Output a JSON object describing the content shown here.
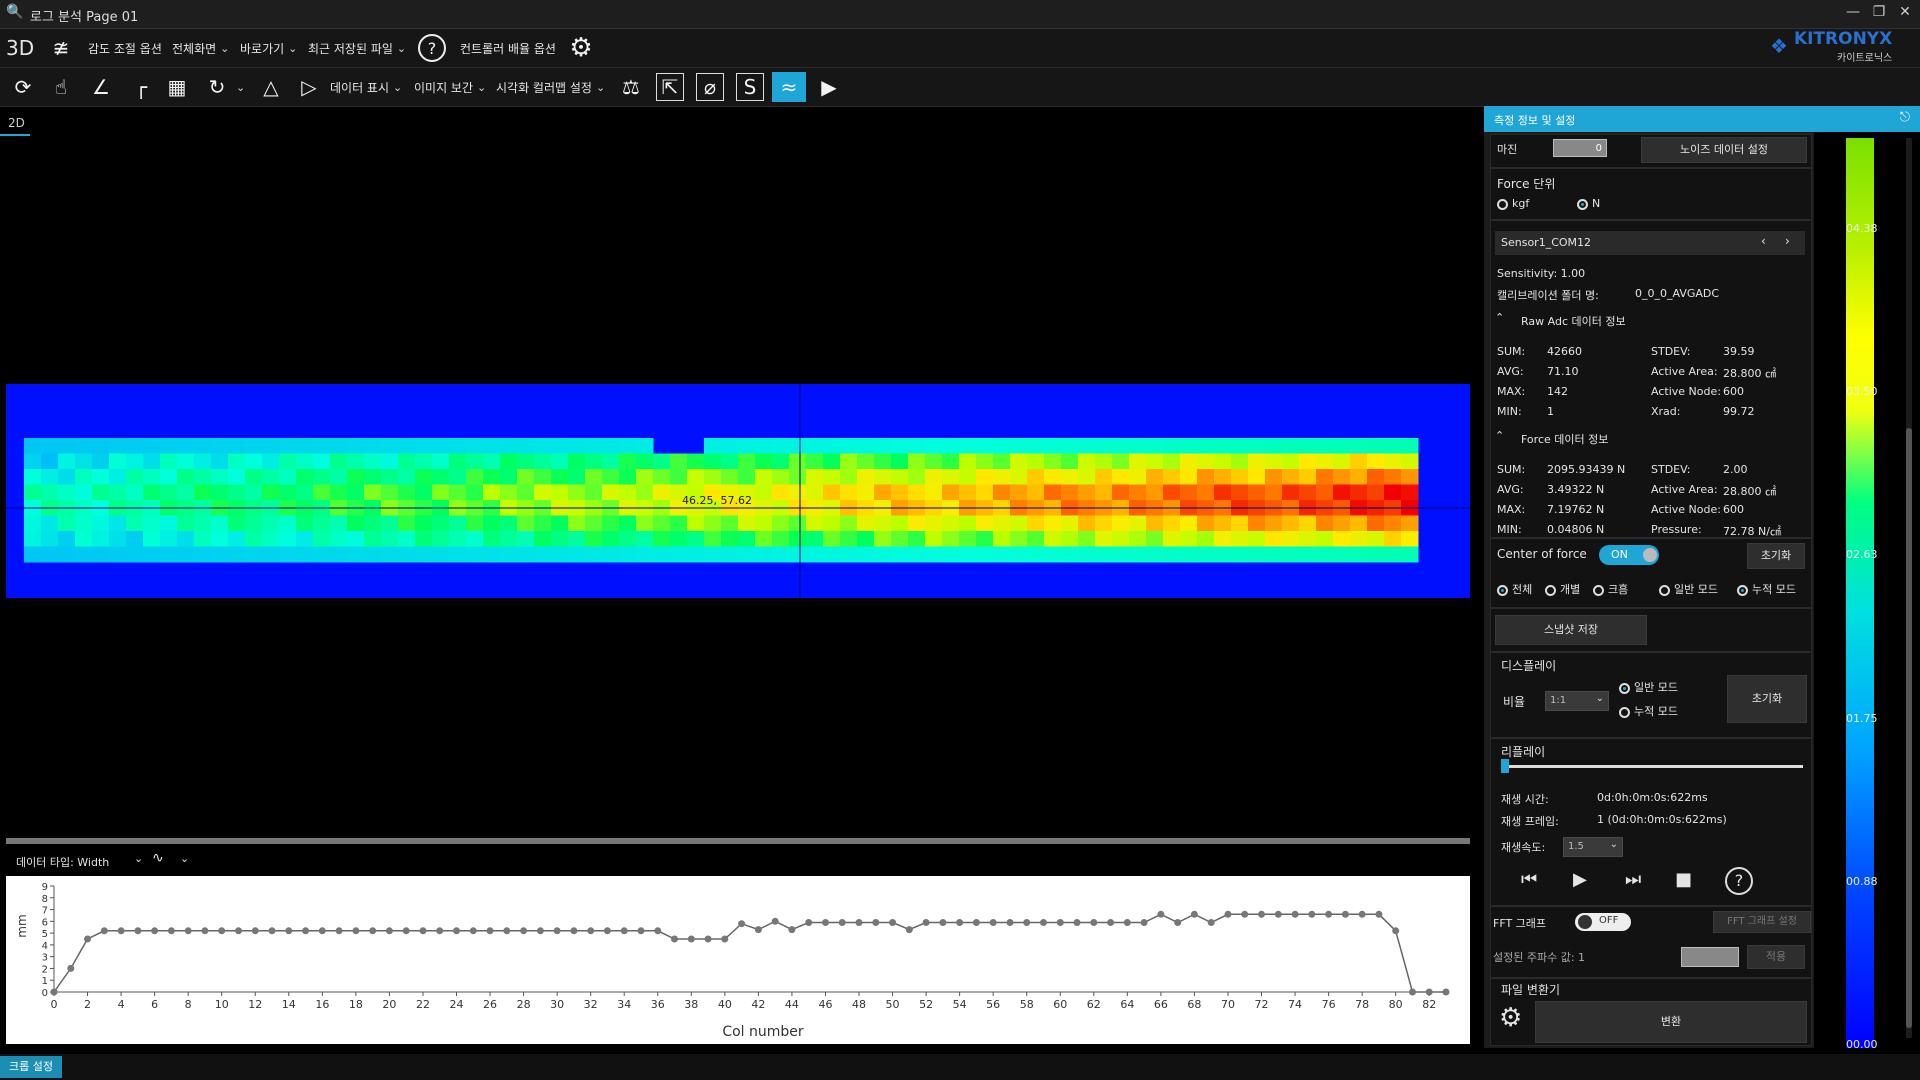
{
  "window": {
    "title": "로그 분석 Page 01"
  },
  "toolbar1": {
    "view3d": "3D",
    "items": [
      "감도 조절 옵션",
      "전체화면",
      "바로가기",
      "최근 저장된 파일",
      "컨트롤러 배율 옵션"
    ]
  },
  "toolbar2": {
    "items": [
      "데이터 표시",
      "이미지 보간",
      "시각화 컬러맵 설정"
    ]
  },
  "logo": {
    "name": "KITRONYX",
    "sub": "카이트로닉스"
  },
  "tabs": {
    "active": "2D"
  },
  "heatmap": {
    "rows": 8,
    "cols": 82,
    "center_label": "46.25, 57.62",
    "axis_color": "#000080"
  },
  "chart_data": {
    "type": "line",
    "title": "",
    "xlabel": "Col number",
    "ylabel": "mm",
    "xlim": [
      0,
      83
    ],
    "ylim": [
      0,
      9
    ],
    "x_ticks": [
      0,
      2,
      4,
      6,
      8,
      10,
      12,
      14,
      16,
      18,
      20,
      22,
      24,
      26,
      28,
      30,
      32,
      34,
      36,
      38,
      40,
      42,
      44,
      46,
      48,
      50,
      52,
      54,
      56,
      58,
      60,
      62,
      64,
      66,
      68,
      70,
      72,
      74,
      76,
      78,
      80,
      82
    ],
    "y_ticks": [
      0,
      1,
      2,
      3,
      4,
      5,
      6,
      7,
      8,
      9
    ],
    "x": [
      0,
      1,
      2,
      3,
      4,
      5,
      6,
      7,
      8,
      9,
      10,
      11,
      12,
      13,
      14,
      15,
      16,
      17,
      18,
      19,
      20,
      21,
      22,
      23,
      24,
      25,
      26,
      27,
      28,
      29,
      30,
      31,
      32,
      33,
      34,
      35,
      36,
      37,
      38,
      39,
      40,
      41,
      42,
      43,
      44,
      45,
      46,
      47,
      48,
      49,
      50,
      51,
      52,
      53,
      54,
      55,
      56,
      57,
      58,
      59,
      60,
      61,
      62,
      63,
      64,
      65,
      66,
      67,
      68,
      69,
      70,
      71,
      72,
      73,
      74,
      75,
      76,
      77,
      78,
      79,
      80,
      81,
      82,
      83
    ],
    "series": [
      {
        "values": [
          0,
          2,
          4.5,
          5.2,
          5.2,
          5.2,
          5.2,
          5.2,
          5.2,
          5.2,
          5.2,
          5.2,
          5.2,
          5.2,
          5.2,
          5.2,
          5.2,
          5.2,
          5.2,
          5.2,
          5.2,
          5.2,
          5.2,
          5.2,
          5.2,
          5.2,
          5.2,
          5.2,
          5.2,
          5.2,
          5.2,
          5.2,
          5.2,
          5.2,
          5.2,
          5.2,
          5.2,
          4.5,
          4.5,
          4.5,
          4.5,
          5.8,
          5.3,
          6,
          5.3,
          5.9,
          5.9,
          5.9,
          5.9,
          5.9,
          5.9,
          5.3,
          5.9,
          5.9,
          5.9,
          5.9,
          5.9,
          5.9,
          5.9,
          5.9,
          5.9,
          5.9,
          5.9,
          5.9,
          5.9,
          5.9,
          6.6,
          5.9,
          6.6,
          5.9,
          6.6,
          6.6,
          6.6,
          6.6,
          6.6,
          6.6,
          6.6,
          6.6,
          6.6,
          6.6,
          5.2,
          0,
          0,
          0
        ]
      }
    ]
  },
  "chart_toolbar": {
    "data_type_label": "데이터 타입: Width"
  },
  "panel": {
    "title": "측정 정보 및 설정",
    "margin_label": "마진",
    "margin_value": "0",
    "noise_btn": "노이즈 데이터 설정",
    "force_unit_label": "Force 단위",
    "unit_kgf": "kgf",
    "unit_n": "N",
    "sensor": "Sensor1_COM12",
    "sensitivity": "Sensitivity:  1.00",
    "calib_label": "캘리브레이션 폴더 명:",
    "calib_value": "0_0_0_AVGADC",
    "raw_title": "Raw Adc 데이터 정보",
    "raw": {
      "sum_l": "SUM:",
      "sum": "42660",
      "stdev_l": "STDEV:",
      "stdev": "39.59",
      "avg_l": "AVG:",
      "avg": "71.10",
      "area_l": "Active Area:",
      "area": "28.800 ㎠",
      "max_l": "MAX:",
      "max": "142",
      "node_l": "Active Node:",
      "node": "600",
      "min_l": "MIN:",
      "min": "1",
      "xrad_l": "Xrad:",
      "xrad": "99.72"
    },
    "force_title": "Force 데이터 정보",
    "force": {
      "sum_l": "SUM:",
      "sum": "2095.93439 N",
      "stdev_l": "STDEV:",
      "stdev": "2.00",
      "avg_l": "AVG:",
      "avg": "3.49322 N",
      "area_l": "Active Area:",
      "area": "28.800 ㎠",
      "max_l": "MAX:",
      "max": "7.19762 N",
      "node_l": "Active Node:",
      "node": "600",
      "min_l": "MIN:",
      "min": "0.04806 N",
      "press_l": "Pressure:",
      "press": "72.78 N/㎠"
    },
    "cof_label": "Center of force",
    "cof_toggle": "ON",
    "reset": "초기화",
    "opt_all": "전체",
    "opt_each": "개별",
    "opt_big": "크흠",
    "opt_normal": "일반 모드",
    "opt_accum": "누적 모드",
    "snapshot": "스냅샷 저장",
    "display_title": "디스플레이",
    "ratio_label": "비율",
    "ratio_value": "1:1",
    "disp_normal": "일반 모드",
    "disp_accum": "누적 모드",
    "disp_reset": "초기화",
    "replay_title": "리플레이",
    "play_time_label": "재생 시간:",
    "play_time": "0d:0h:0m:0s:622ms",
    "play_frame_label": "재생 프레임:",
    "play_frame": "1 (0d:0h:0m:0s:622ms)",
    "speed_label": "재생속도:",
    "speed_value": "1.5",
    "fft_label": "FFT 그래프",
    "fft_toggle": "OFF",
    "fft_setting": "FFT 그래프 설정",
    "freq_label": "설정된 주파수 값: 1",
    "apply": "적용",
    "file_conv_title": "파일 변환기",
    "convert": "변환"
  },
  "colorbar": {
    "ticks": [
      "04.38",
      "03.50",
      "02.63",
      "01.75",
      "00.88",
      "00.00"
    ]
  },
  "status": {
    "zoom_btn": "크롭 설정"
  },
  "colors": {
    "accent": "#1fa6d6",
    "toggle_on": "#1fa6d6"
  }
}
